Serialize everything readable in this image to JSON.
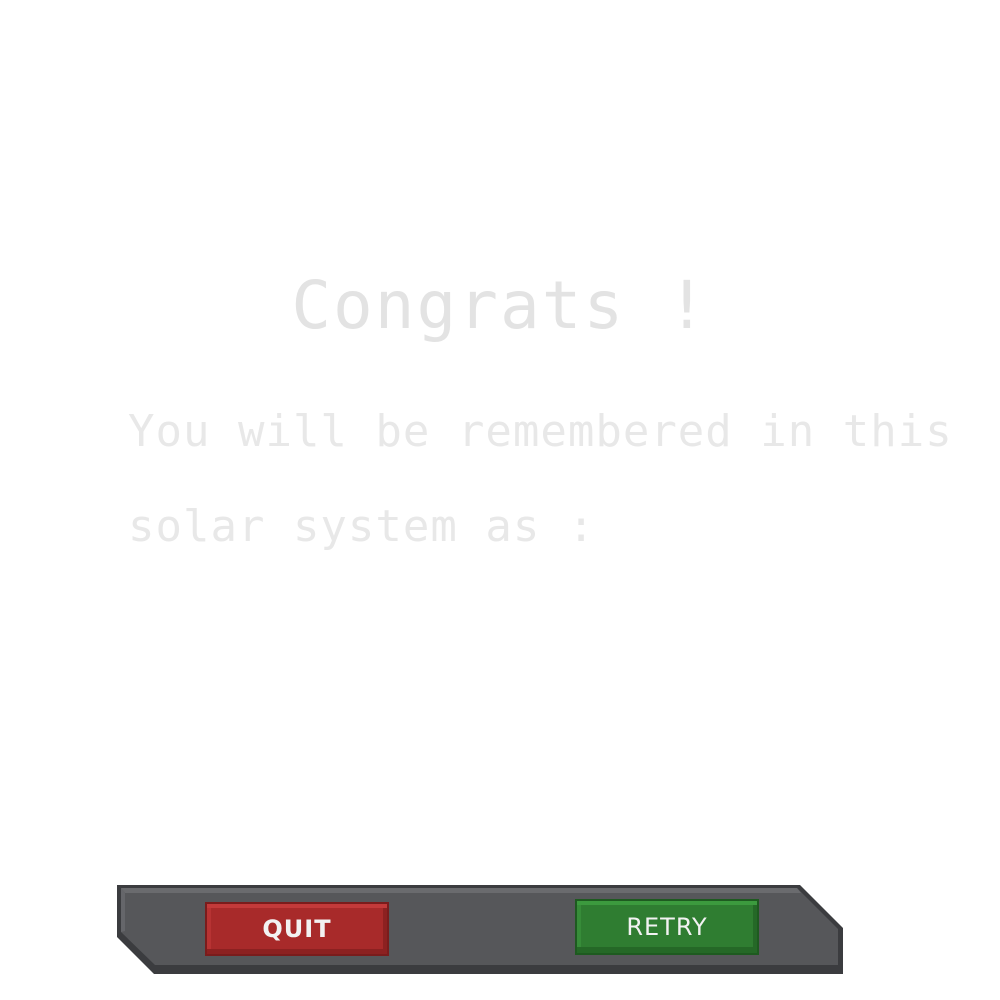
{
  "dialog": {
    "title": "Congrats !",
    "message_line1": "You will be remembered in this",
    "message_line2": "solar system as :"
  },
  "actions": {
    "quit_label": "QUIT",
    "retry_label": "RETRY"
  },
  "colors": {
    "background": "#ffffff",
    "text": "#e3e3e3",
    "panel": "#56575a",
    "quit": "#a82a2a",
    "retry": "#2f7d31"
  }
}
